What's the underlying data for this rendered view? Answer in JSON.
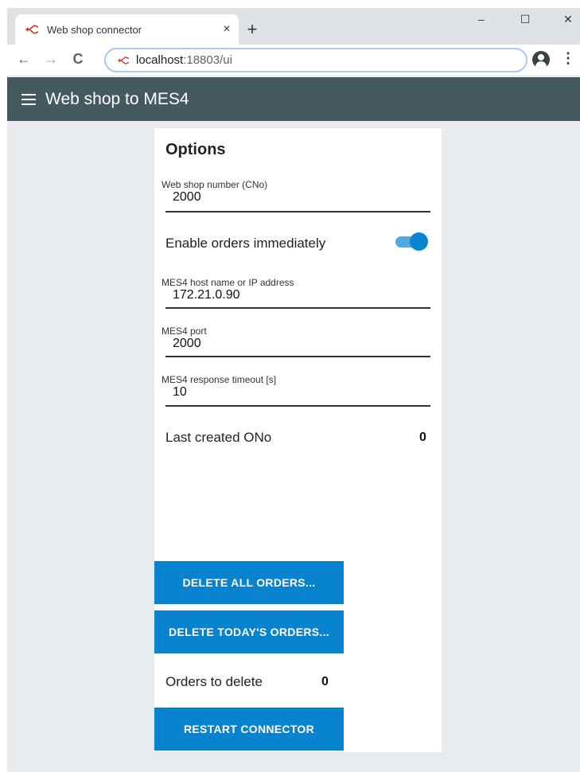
{
  "browser": {
    "tab_title": "Web shop connector",
    "tab_close": "×",
    "new_tab": "+",
    "url_host": "localhost",
    "url_path": ":18803/ui",
    "window_controls": {
      "minimize": "–",
      "maximize": "☐",
      "close": "✕"
    },
    "nav": {
      "back": "←",
      "forward": "→",
      "reload": "C"
    },
    "menu": "⋮",
    "favicon_color": "#d93025"
  },
  "app": {
    "title": "Web shop to MES4",
    "appbar_color": "#455a5f",
    "accent": "#0883cf"
  },
  "options": {
    "title": "Options",
    "webshop_number": {
      "label": "Web shop number (CNo)",
      "value": "2000"
    },
    "enable_orders": {
      "label": "Enable orders immediately",
      "enabled": true
    },
    "mes4_host": {
      "label": "MES4 host name or IP address",
      "value": "172.21.0.90"
    },
    "mes4_port": {
      "label": "MES4 port",
      "value": "2000"
    },
    "mes4_timeout": {
      "label": "MES4 response timeout [s]",
      "value": "10"
    },
    "last_created": {
      "label": "Last created ONo",
      "value": "0"
    }
  },
  "actions": {
    "delete_all": "DELETE ALL ORDERS...",
    "delete_today": "DELETE TODAY'S ORDERS...",
    "orders_to_delete": {
      "label": "Orders to delete",
      "value": "0"
    },
    "restart": "RESTART CONNECTOR"
  }
}
